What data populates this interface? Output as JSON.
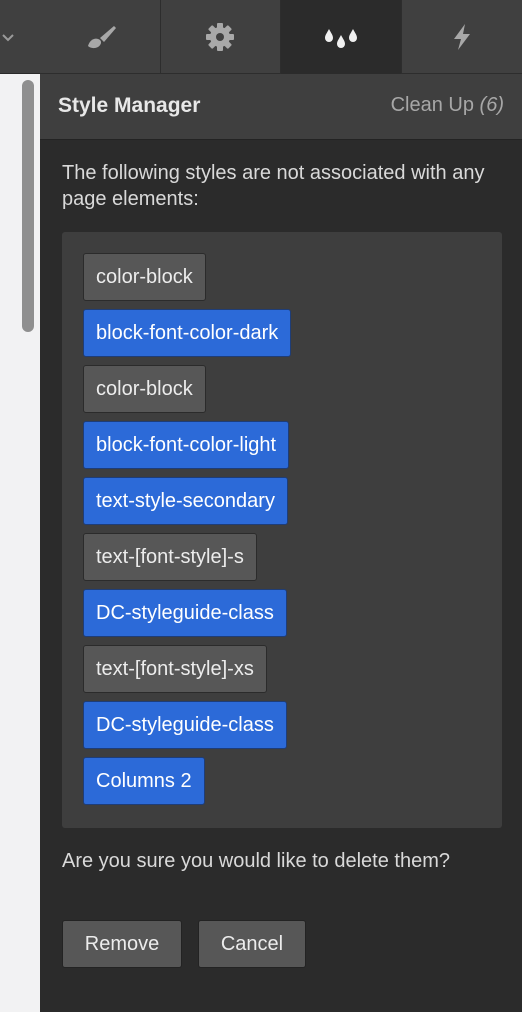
{
  "tabs": [
    {
      "icon": "paintbrush-icon",
      "active": false
    },
    {
      "icon": "gear-icon",
      "active": false
    },
    {
      "icon": "drops-icon",
      "active": true
    },
    {
      "icon": "lightning-icon",
      "active": false
    }
  ],
  "panel": {
    "title": "Style Manager",
    "cleanup_label": "Clean Up",
    "cleanup_count": "(6)",
    "intro": "The following styles are not associated with any page elements:",
    "confirm": "Are you sure you would like to delete them?",
    "remove_label": "Remove",
    "cancel_label": "Cancel"
  },
  "styles": [
    {
      "label": "color-block",
      "kind": "gray"
    },
    {
      "label": "block-font-color-dark",
      "kind": "blue"
    },
    {
      "label": "color-block",
      "kind": "gray"
    },
    {
      "label": "block-font-color-light",
      "kind": "blue"
    },
    {
      "label": "text-style-secondary",
      "kind": "blue"
    },
    {
      "label": "text-[font-style]-s",
      "kind": "gray"
    },
    {
      "label": "DC-styleguide-class",
      "kind": "blue"
    },
    {
      "label": "text-[font-style]-xs",
      "kind": "gray"
    },
    {
      "label": "DC-styleguide-class",
      "kind": "blue"
    },
    {
      "label": "Columns 2",
      "kind": "blue"
    }
  ],
  "colors": {
    "accent_blue": "#2c6ad8",
    "chip_gray": "#575757",
    "panel_bg": "#2b2b2b",
    "header_bg": "#3f3f3f"
  }
}
